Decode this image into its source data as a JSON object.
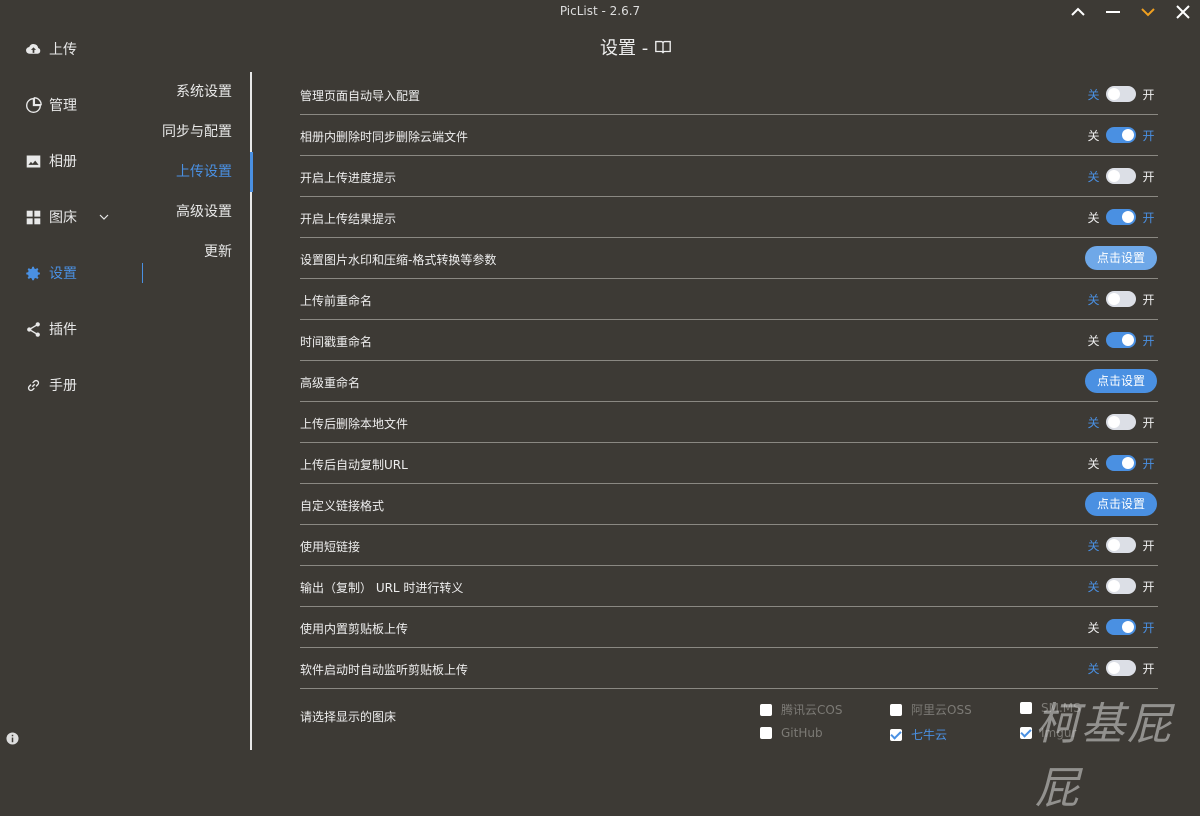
{
  "window": {
    "title": "PicList - 2.6.7",
    "controls": [
      "chevron-up-icon",
      "minimize-icon",
      "chevron-down-icon",
      "close-icon"
    ],
    "accent_down_color": "#f0a020"
  },
  "sidebar": {
    "items": [
      {
        "label": "上传",
        "icon": "cloud-upload-icon"
      },
      {
        "label": "管理",
        "icon": "pie-chart-icon"
      },
      {
        "label": "相册",
        "icon": "image-icon"
      },
      {
        "label": "图床",
        "icon": "grid-icon"
      },
      {
        "label": "设置",
        "icon": "gear-icon",
        "active": true
      },
      {
        "label": "插件",
        "icon": "share-icon"
      },
      {
        "label": "手册",
        "icon": "link-icon"
      }
    ]
  },
  "header": {
    "title": "设置 -",
    "icon": "book-icon"
  },
  "subnav": {
    "items": [
      {
        "label": "系统设置"
      },
      {
        "label": "同步与配置"
      },
      {
        "label": "上传设置",
        "active": true
      },
      {
        "label": "高级设置"
      },
      {
        "label": "更新"
      }
    ]
  },
  "switch_labels": {
    "off": "关",
    "on": "开"
  },
  "settings": {
    "rows": [
      {
        "label": "管理页面自动导入配置",
        "type": "toggle",
        "on": false
      },
      {
        "label": "相册内删除时同步删除云端文件",
        "type": "toggle",
        "on": true
      },
      {
        "label": "开启上传进度提示",
        "type": "toggle",
        "on": false
      },
      {
        "label": "开启上传结果提示",
        "type": "toggle",
        "on": true
      },
      {
        "label": "设置图片水印和压缩-格式转换等参数",
        "type": "button",
        "button": "点击设置",
        "soft": true
      },
      {
        "label": "上传前重命名",
        "type": "toggle",
        "on": false
      },
      {
        "label": "时间戳重命名",
        "type": "toggle",
        "on": true
      },
      {
        "label": "高级重命名",
        "type": "button",
        "button": "点击设置"
      },
      {
        "label": "上传后删除本地文件",
        "type": "toggle",
        "on": false
      },
      {
        "label": "上传后自动复制URL",
        "type": "toggle",
        "on": true
      },
      {
        "label": "自定义链接格式",
        "type": "button",
        "button": "点击设置"
      },
      {
        "label": "使用短链接",
        "type": "toggle",
        "on": false
      },
      {
        "label": "输出（复制） URL 时进行转义",
        "type": "toggle",
        "on": false
      },
      {
        "label": "使用内置剪贴板上传",
        "type": "toggle",
        "on": true
      },
      {
        "label": "软件启动时自动监听剪贴板上传",
        "type": "toggle",
        "on": false
      }
    ],
    "picbed_label": "请选择显示的图床",
    "picbeds": [
      {
        "label": "腾讯云COS",
        "checked": false
      },
      {
        "label": "阿里云OSS",
        "checked": false
      },
      {
        "label": "SM.MS",
        "checked": false
      },
      {
        "label": "GitHub",
        "checked": false
      },
      {
        "label": "七牛云",
        "checked": true
      },
      {
        "label": "Imgur",
        "checked": true
      }
    ]
  },
  "watermark": "柯基屁屁",
  "footer": {
    "icon": "info-icon"
  }
}
